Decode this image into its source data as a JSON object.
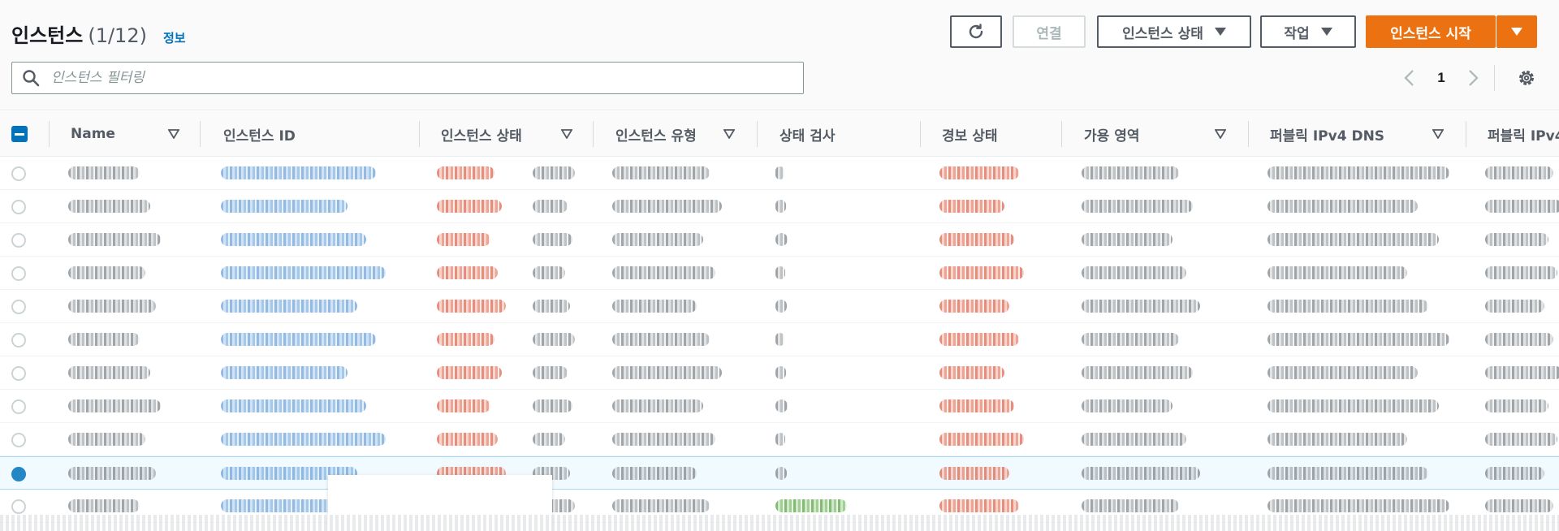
{
  "header": {
    "title": "인스턴스",
    "count": "(1/12)",
    "info_link": "정보"
  },
  "toolbar": {
    "connect_label": "연결",
    "instance_state_label": "인스턴스 상태",
    "actions_label": "작업",
    "launch_label": "인스턴스 시작"
  },
  "search": {
    "placeholder": "인스턴스 필터링",
    "value": ""
  },
  "pagination": {
    "current_page": "1"
  },
  "table": {
    "columns": [
      "Name",
      "인스턴스 ID",
      "인스턴스 상태",
      "인스턴스 유형",
      "상태 검사",
      "경보 상태",
      "가용 영역",
      "퍼블릭 IPv4 DNS",
      "퍼블릭 IPv4"
    ],
    "row_count": 11,
    "selected_row_index": 9
  },
  "colors": {
    "primary_orange": "#ec7211",
    "link_blue": "#0073bb",
    "text_dark": "#16191f",
    "text_gray": "#545b64",
    "error_red": "#d13212",
    "success_green": "#1d8102"
  },
  "icons": [
    "refresh-icon",
    "caret-down-icon",
    "search-icon",
    "chevron-left-icon",
    "chevron-right-icon",
    "gear-icon",
    "sort-icon"
  ]
}
